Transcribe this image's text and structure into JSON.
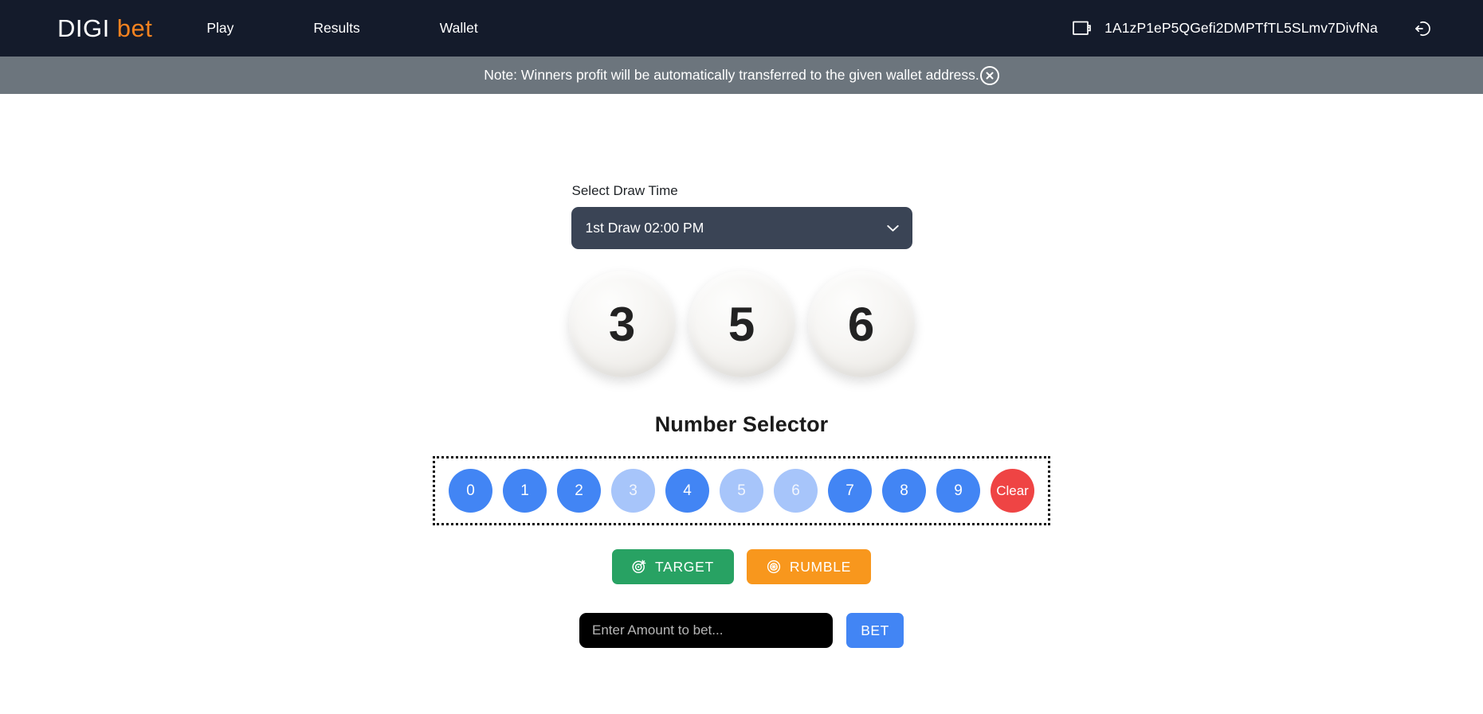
{
  "navbar": {
    "brand_primary": "DIGI",
    "brand_accent": "bet",
    "links": [
      {
        "label": "Play"
      },
      {
        "label": "Results"
      },
      {
        "label": "Wallet"
      }
    ],
    "wallet_icon": "wallet-icon",
    "wallet_address": "1A1zP1eP5QGefi2DMPTfTL5SLmv7DivfNa",
    "logout_icon": "logout-icon",
    "background_color": "#141b2b",
    "accent_color": "#f5821f"
  },
  "note_banner": {
    "text": "Note: Winners profit will be automatically transferred to the given wallet address.",
    "close_icon": "close-circle-icon",
    "background_color": "#6c757d"
  },
  "draw": {
    "label": "Select Draw Time",
    "selected": "1st Draw 02:00 PM",
    "chevron_icon": "chevron-down-icon",
    "options": [
      "1st Draw 02:00 PM"
    ]
  },
  "balls": [
    {
      "value": "3"
    },
    {
      "value": "5"
    },
    {
      "value": "6"
    }
  ],
  "selector": {
    "title": "Number Selector",
    "numbers": [
      {
        "label": "0",
        "used": false
      },
      {
        "label": "1",
        "used": false
      },
      {
        "label": "2",
        "used": false
      },
      {
        "label": "3",
        "used": true
      },
      {
        "label": "4",
        "used": false
      },
      {
        "label": "5",
        "used": true
      },
      {
        "label": "6",
        "used": true
      },
      {
        "label": "7",
        "used": false
      },
      {
        "label": "8",
        "used": false
      },
      {
        "label": "9",
        "used": false
      }
    ],
    "clear_label": "Clear",
    "active_color": "#4285f4",
    "used_color": "#a7c5fa",
    "clear_color": "#ef4444"
  },
  "modes": {
    "target_label": "TARGET",
    "target_icon": "target-icon",
    "target_color": "#28a263",
    "rumble_label": "RUMBLE",
    "rumble_icon": "rumble-icon",
    "rumble_color": "#f8971d"
  },
  "bet": {
    "placeholder": "Enter Amount to bet...",
    "value": "",
    "button_label": "BET",
    "button_color": "#4285f4"
  }
}
